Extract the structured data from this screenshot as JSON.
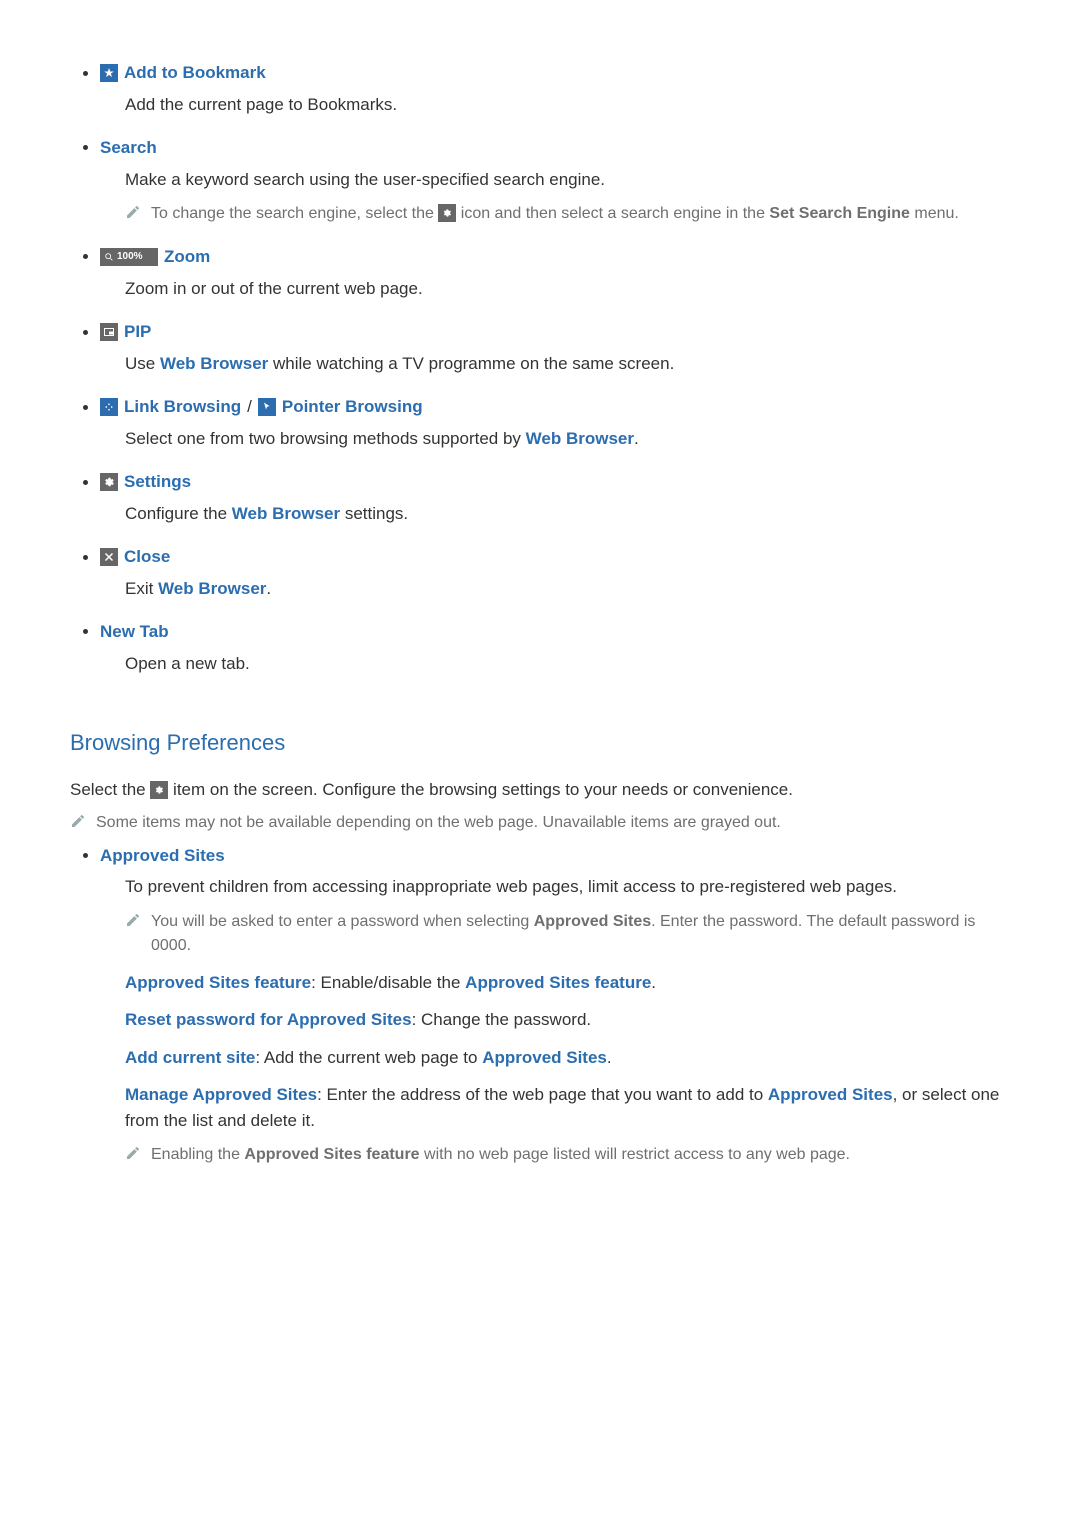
{
  "items": [
    {
      "label": "Add to Bookmark",
      "desc": "Add the current page to Bookmarks."
    },
    {
      "label": "Search",
      "desc": "Make a keyword search using the user-specified search engine.",
      "note_pre": "To change the search engine, select the ",
      "note_post": " icon and then select a search engine in the ",
      "note_bold": "Set Search Engine",
      "note_tail": " menu."
    },
    {
      "label": "Zoom",
      "zoom_text": "100%",
      "desc": "Zoom in or out of the current web page."
    },
    {
      "label": "PIP",
      "desc_pre": "Use ",
      "desc_bold": "Web Browser",
      "desc_post": " while watching a TV programme on the same screen."
    },
    {
      "label1": "Link Browsing",
      "sep": " / ",
      "label2": "Pointer Browsing",
      "desc_pre": "Select one from two browsing methods supported by ",
      "desc_bold": "Web Browser",
      "desc_post": "."
    },
    {
      "label": "Settings",
      "desc_pre": "Configure the ",
      "desc_bold": "Web Browser",
      "desc_post": " settings."
    },
    {
      "label": "Close",
      "desc_pre": "Exit ",
      "desc_bold": "Web Browser",
      "desc_post": "."
    },
    {
      "label": "New Tab",
      "desc": "Open a new tab."
    }
  ],
  "section2": {
    "title": "Browsing Preferences",
    "intro_pre": "Select the ",
    "intro_post": " item on the screen. Configure the browsing settings to your needs or convenience.",
    "note": "Some items may not be available depending on the web page. Unavailable items are grayed out.",
    "approved": {
      "label": "Approved Sites",
      "desc": "To prevent children from accessing inappropriate web pages, limit access to pre-registered web pages.",
      "note_pre": "You will be asked to enter a password when selecting ",
      "note_bold": "Approved Sites",
      "note_post": ". Enter the password. The default password is 0000.",
      "sub1_label": "Approved Sites feature",
      "sub1_sep": ": Enable/disable the ",
      "sub1_bold": "Approved Sites feature",
      "sub1_tail": ".",
      "sub2_label": "Reset password for Approved Sites",
      "sub2_tail": ": Change the password.",
      "sub3_label": "Add current site",
      "sub3_mid": ": Add the current web page to ",
      "sub3_bold": "Approved Sites",
      "sub3_tail": ".",
      "sub4_label": "Manage Approved Sites",
      "sub4_mid": ": Enter the address of the web page that you want to add to ",
      "sub4_bold": "Approved Sites",
      "sub4_tail": ", or select one from the list and delete it.",
      "note2_pre": "Enabling the ",
      "note2_bold": "Approved Sites feature",
      "note2_post": " with no web page listed will restrict access to any web page."
    }
  }
}
